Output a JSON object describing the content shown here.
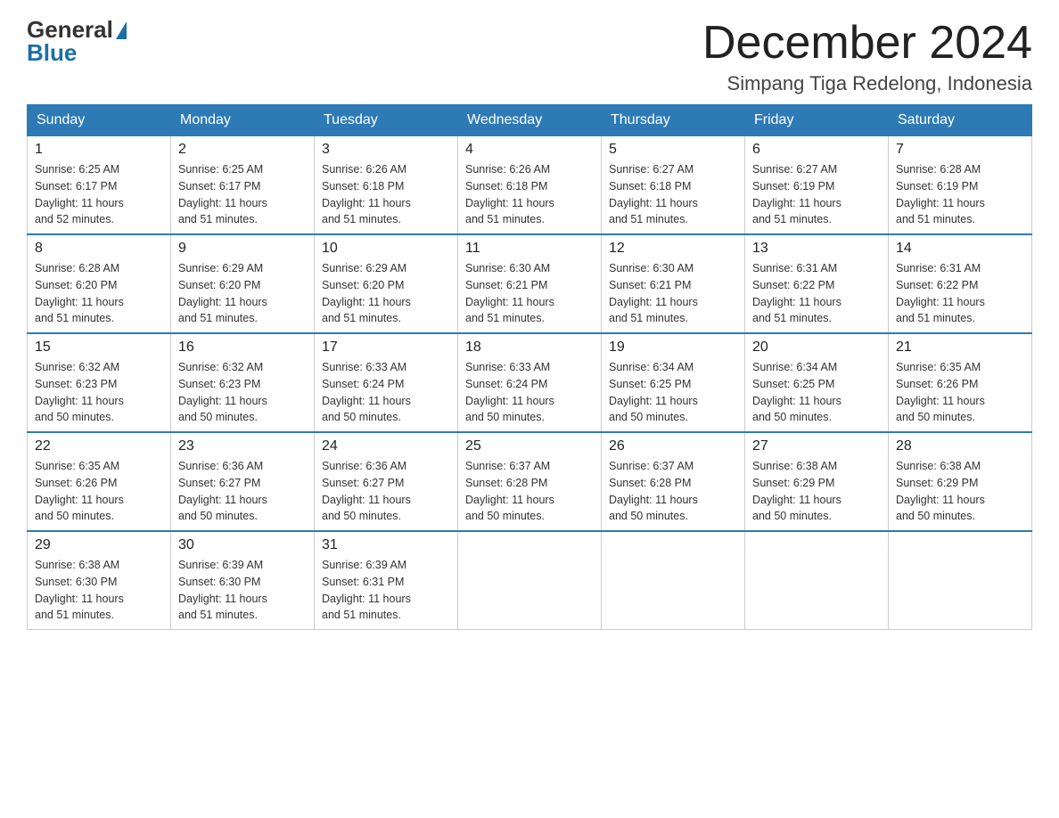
{
  "header": {
    "logo_general": "General",
    "logo_blue": "Blue",
    "month_title": "December 2024",
    "location": "Simpang Tiga Redelong, Indonesia"
  },
  "days_of_week": [
    "Sunday",
    "Monday",
    "Tuesday",
    "Wednesday",
    "Thursday",
    "Friday",
    "Saturday"
  ],
  "weeks": [
    [
      {
        "day": "1",
        "sunrise": "6:25 AM",
        "sunset": "6:17 PM",
        "daylight": "11 hours and 52 minutes."
      },
      {
        "day": "2",
        "sunrise": "6:25 AM",
        "sunset": "6:17 PM",
        "daylight": "11 hours and 51 minutes."
      },
      {
        "day": "3",
        "sunrise": "6:26 AM",
        "sunset": "6:18 PM",
        "daylight": "11 hours and 51 minutes."
      },
      {
        "day": "4",
        "sunrise": "6:26 AM",
        "sunset": "6:18 PM",
        "daylight": "11 hours and 51 minutes."
      },
      {
        "day": "5",
        "sunrise": "6:27 AM",
        "sunset": "6:18 PM",
        "daylight": "11 hours and 51 minutes."
      },
      {
        "day": "6",
        "sunrise": "6:27 AM",
        "sunset": "6:19 PM",
        "daylight": "11 hours and 51 minutes."
      },
      {
        "day": "7",
        "sunrise": "6:28 AM",
        "sunset": "6:19 PM",
        "daylight": "11 hours and 51 minutes."
      }
    ],
    [
      {
        "day": "8",
        "sunrise": "6:28 AM",
        "sunset": "6:20 PM",
        "daylight": "11 hours and 51 minutes."
      },
      {
        "day": "9",
        "sunrise": "6:29 AM",
        "sunset": "6:20 PM",
        "daylight": "11 hours and 51 minutes."
      },
      {
        "day": "10",
        "sunrise": "6:29 AM",
        "sunset": "6:20 PM",
        "daylight": "11 hours and 51 minutes."
      },
      {
        "day": "11",
        "sunrise": "6:30 AM",
        "sunset": "6:21 PM",
        "daylight": "11 hours and 51 minutes."
      },
      {
        "day": "12",
        "sunrise": "6:30 AM",
        "sunset": "6:21 PM",
        "daylight": "11 hours and 51 minutes."
      },
      {
        "day": "13",
        "sunrise": "6:31 AM",
        "sunset": "6:22 PM",
        "daylight": "11 hours and 51 minutes."
      },
      {
        "day": "14",
        "sunrise": "6:31 AM",
        "sunset": "6:22 PM",
        "daylight": "11 hours and 51 minutes."
      }
    ],
    [
      {
        "day": "15",
        "sunrise": "6:32 AM",
        "sunset": "6:23 PM",
        "daylight": "11 hours and 50 minutes."
      },
      {
        "day": "16",
        "sunrise": "6:32 AM",
        "sunset": "6:23 PM",
        "daylight": "11 hours and 50 minutes."
      },
      {
        "day": "17",
        "sunrise": "6:33 AM",
        "sunset": "6:24 PM",
        "daylight": "11 hours and 50 minutes."
      },
      {
        "day": "18",
        "sunrise": "6:33 AM",
        "sunset": "6:24 PM",
        "daylight": "11 hours and 50 minutes."
      },
      {
        "day": "19",
        "sunrise": "6:34 AM",
        "sunset": "6:25 PM",
        "daylight": "11 hours and 50 minutes."
      },
      {
        "day": "20",
        "sunrise": "6:34 AM",
        "sunset": "6:25 PM",
        "daylight": "11 hours and 50 minutes."
      },
      {
        "day": "21",
        "sunrise": "6:35 AM",
        "sunset": "6:26 PM",
        "daylight": "11 hours and 50 minutes."
      }
    ],
    [
      {
        "day": "22",
        "sunrise": "6:35 AM",
        "sunset": "6:26 PM",
        "daylight": "11 hours and 50 minutes."
      },
      {
        "day": "23",
        "sunrise": "6:36 AM",
        "sunset": "6:27 PM",
        "daylight": "11 hours and 50 minutes."
      },
      {
        "day": "24",
        "sunrise": "6:36 AM",
        "sunset": "6:27 PM",
        "daylight": "11 hours and 50 minutes."
      },
      {
        "day": "25",
        "sunrise": "6:37 AM",
        "sunset": "6:28 PM",
        "daylight": "11 hours and 50 minutes."
      },
      {
        "day": "26",
        "sunrise": "6:37 AM",
        "sunset": "6:28 PM",
        "daylight": "11 hours and 50 minutes."
      },
      {
        "day": "27",
        "sunrise": "6:38 AM",
        "sunset": "6:29 PM",
        "daylight": "11 hours and 50 minutes."
      },
      {
        "day": "28",
        "sunrise": "6:38 AM",
        "sunset": "6:29 PM",
        "daylight": "11 hours and 50 minutes."
      }
    ],
    [
      {
        "day": "29",
        "sunrise": "6:38 AM",
        "sunset": "6:30 PM",
        "daylight": "11 hours and 51 minutes."
      },
      {
        "day": "30",
        "sunrise": "6:39 AM",
        "sunset": "6:30 PM",
        "daylight": "11 hours and 51 minutes."
      },
      {
        "day": "31",
        "sunrise": "6:39 AM",
        "sunset": "6:31 PM",
        "daylight": "11 hours and 51 minutes."
      },
      null,
      null,
      null,
      null
    ]
  ],
  "labels": {
    "sunrise": "Sunrise:",
    "sunset": "Sunset:",
    "daylight": "Daylight:"
  }
}
